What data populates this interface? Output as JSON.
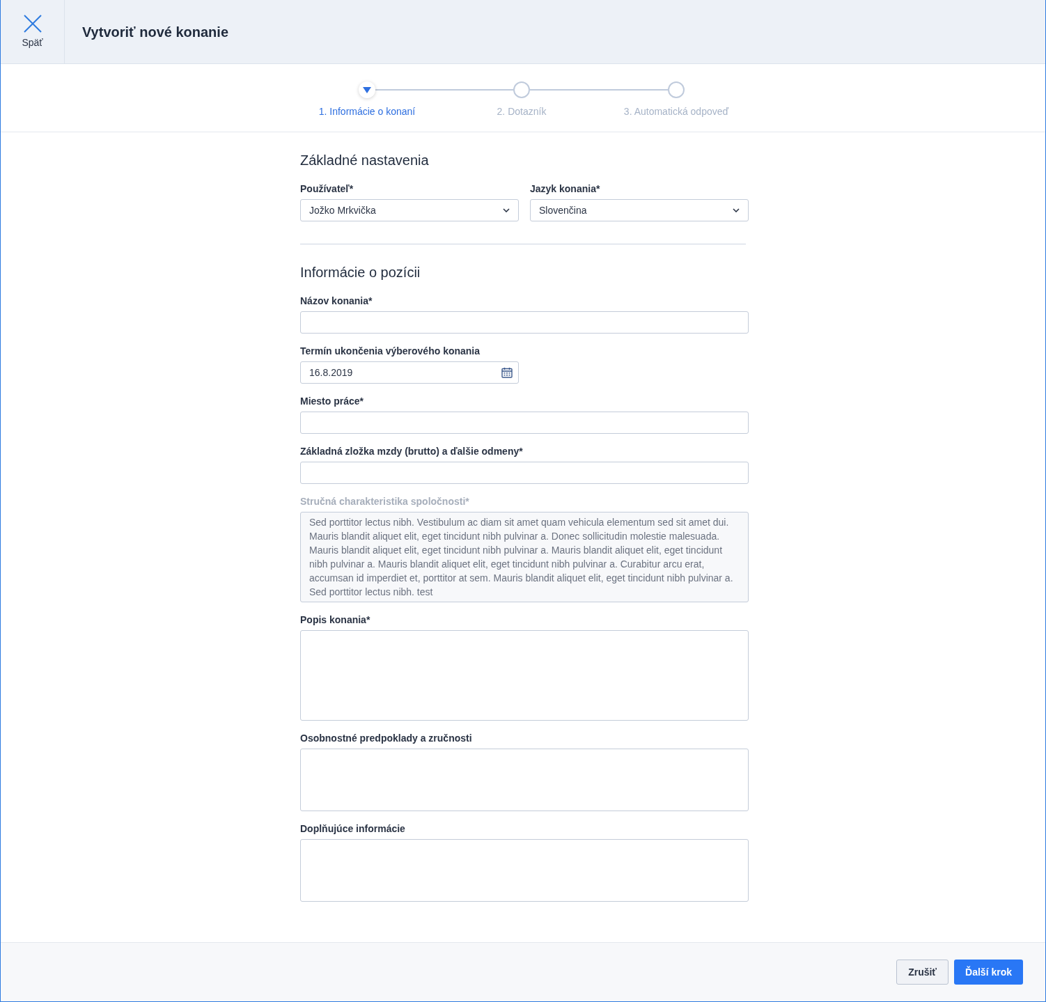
{
  "header": {
    "back_label": "Späť",
    "title": "Vytvoriť nové konanie"
  },
  "steps": [
    {
      "label": "1. Informácie o konaní",
      "selected": true
    },
    {
      "label": "2. Dotazník",
      "selected": false
    },
    {
      "label": "3. Automatická odpoveď",
      "selected": false
    }
  ],
  "sections": [
    {
      "title": "Základné nastavenia",
      "fields": [
        {
          "kind": "select",
          "label": "Používateľ*",
          "value": "Jožko Mrkvička",
          "disabled": false
        },
        {
          "kind": "select",
          "label": "Jazyk konania*",
          "value": "Slovenčina",
          "disabled": false
        }
      ]
    },
    {
      "title": "Informácie o pozícii",
      "fields": [
        {
          "kind": "text",
          "label": "Názov konania*",
          "disabled": false
        },
        {
          "kind": "date",
          "label": "Termín ukončenia výberového konania",
          "value": "16.8.2019",
          "disabled": false
        },
        {
          "kind": "text",
          "label": "Miesto práce*",
          "disabled": false
        },
        {
          "kind": "text",
          "label": "Základná zložka mzdy (brutto) a ďalšie odmeny*",
          "disabled": false
        },
        {
          "kind": "textarea",
          "label": "Stručná charakteristika spoločnosti*",
          "value": "Sed porttitor lectus nibh. Vestibulum ac diam sit amet quam vehicula elementum sed sit amet dui. Mauris blandit aliquet elit, eget tincidunt nibh pulvinar a. Donec sollicitudin molestie malesuada. Mauris blandit aliquet elit, eget tincidunt nibh pulvinar a. Mauris blandit aliquet elit, eget tincidunt nibh pulvinar a. Mauris blandit aliquet elit, eget tincidunt nibh pulvinar a. Curabitur arcu erat, accumsan id imperdiet et, porttitor at sem. Mauris blandit aliquet elit, eget tincidunt nibh pulvinar a. Sed porttitor lectus nibh. test",
          "disabled": true
        },
        {
          "kind": "textarea",
          "label": "Popis konania*",
          "disabled": false
        },
        {
          "kind": "short_textarea",
          "label": "Osobnostné predpoklady a zručnosti",
          "disabled": false
        },
        {
          "kind": "short_textarea",
          "label": "Doplňujúce informácie",
          "disabled": false
        }
      ]
    }
  ],
  "footer": {
    "buttons": [
      {
        "kind": "secondary",
        "label": "Zrušiť"
      },
      {
        "kind": "primary",
        "label": "Ďalší krok"
      }
    ]
  }
}
